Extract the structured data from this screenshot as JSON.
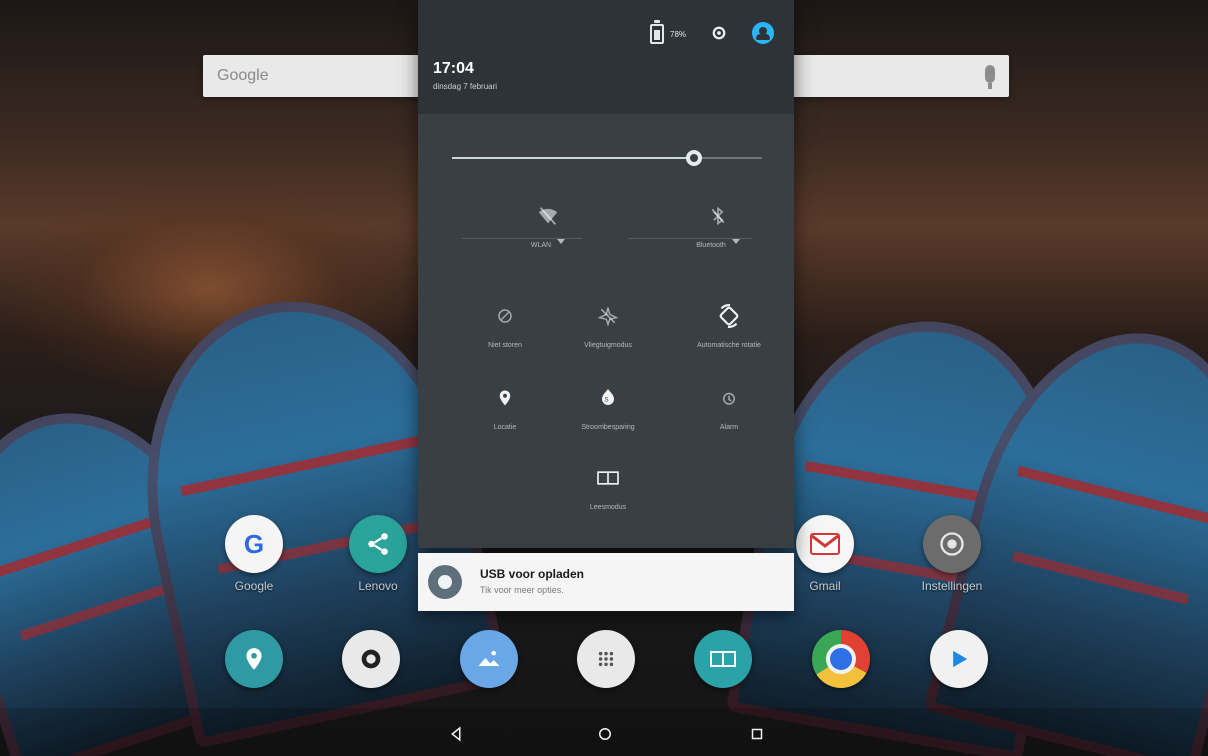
{
  "search": {
    "brand": "Google"
  },
  "home_apps": [
    {
      "name": "Google",
      "label": "Google"
    },
    {
      "name": "Share",
      "label": "Lenovo"
    },
    {
      "name": "Gmail",
      "label": "Gmail"
    },
    {
      "name": "Settings",
      "label": "Instellingen"
    }
  ],
  "shade": {
    "time": "17:04",
    "date": "dinsdag 7 februari",
    "battery_percent": "78%",
    "brightness_level": 0.78,
    "tiles": {
      "wifi": {
        "label": "WLAN"
      },
      "bluetooth": {
        "label": "Bluetooth"
      },
      "dnd": {
        "label": "Niet storen"
      },
      "airplane": {
        "label": "Vliegtuigmodus"
      },
      "rotate": {
        "label": "Automatische rotatie"
      },
      "location": {
        "label": "Locatie"
      },
      "saver": {
        "label": "Stroombesparing"
      },
      "alarm": {
        "label": "Alarm"
      },
      "reader": {
        "label": "Leesmodus"
      }
    }
  },
  "usb_notification": {
    "title": "USB voor opladen",
    "subtitle": "Tik voor meer opties."
  },
  "colors": {
    "shade_bg": "#3a3f43",
    "shade_header_bg": "#2e3337",
    "accent_user": "#29b6f6",
    "notification_bg": "#f5f5f5"
  }
}
